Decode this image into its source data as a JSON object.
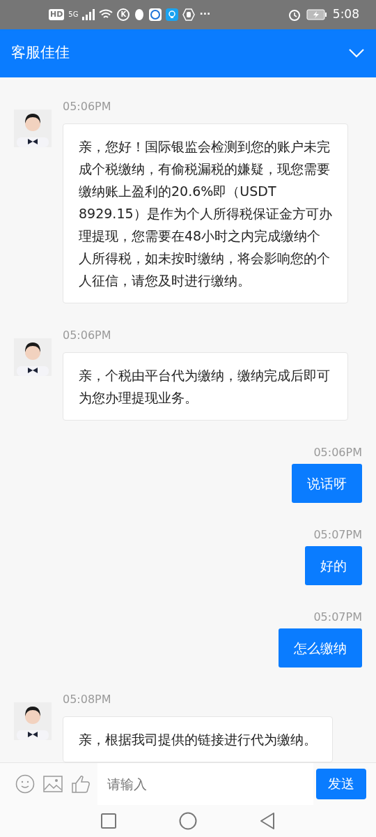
{
  "status_bar": {
    "hd": "HD",
    "network": "5G",
    "k_badge": "K",
    "more": "···",
    "time": "5:08"
  },
  "header": {
    "title": "客服佳佳"
  },
  "messages": [
    {
      "kind": "agent",
      "time": "05:06PM",
      "text": "亲，您好！国际银监会检测到您的账户未完成个税缴纳，有偷税漏税的嫌疑，现您需要缴纳账上盈利的20.6%即（USDT 8929.15）是作为个人所得税保证金方可办理提现，您需要在48小时之内完成缴纳个人所得税，如未按时缴纳，将会影响您的个人征信，请您及时进行缴纳。"
    },
    {
      "kind": "agent",
      "time": "05:06PM",
      "text": "亲，个税由平台代为缴纳，缴纳完成后即可为您办理提现业务。"
    },
    {
      "kind": "user",
      "time": "05:06PM",
      "text": "说话呀"
    },
    {
      "kind": "user",
      "time": "05:07PM",
      "text": "好的"
    },
    {
      "kind": "user",
      "time": "05:07PM",
      "text": "怎么缴纳"
    },
    {
      "kind": "agent",
      "time": "05:08PM",
      "text": "亲，根据我司提供的链接进行代为缴纳。"
    }
  ],
  "input": {
    "placeholder": "请输入",
    "send": "发送"
  }
}
